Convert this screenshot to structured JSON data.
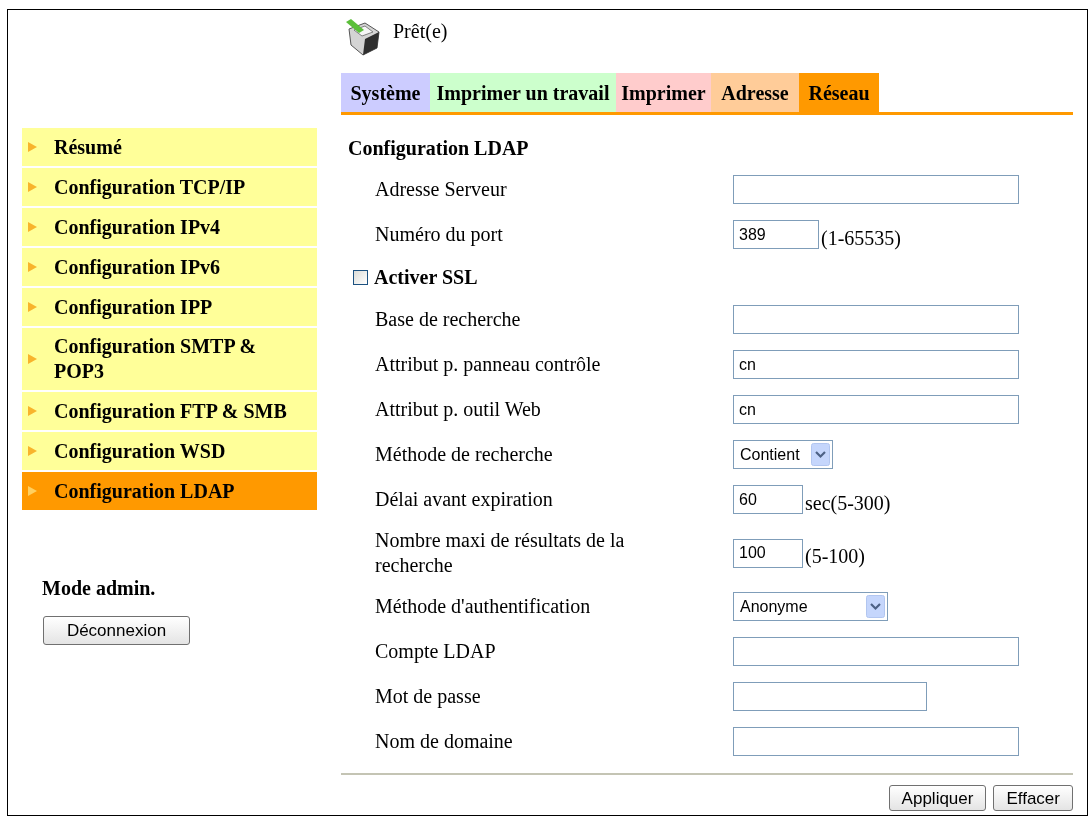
{
  "status": {
    "text": "Prêt(e)"
  },
  "tabs": [
    {
      "label": "Système",
      "color": "#ccccff",
      "selected": false
    },
    {
      "label": "Imprimer un travail",
      "color": "#ccffcc",
      "selected": false
    },
    {
      "label": "Imprimer",
      "color": "#ffcccc",
      "selected": false
    },
    {
      "label": "Adresse",
      "color": "#ffcc99",
      "selected": false
    },
    {
      "label": "Réseau",
      "color": "#ff9900",
      "selected": true
    }
  ],
  "sidebar": {
    "items": [
      {
        "label": "Résumé",
        "selected": false
      },
      {
        "label": "Configuration TCP/IP",
        "selected": false
      },
      {
        "label": "Configuration IPv4",
        "selected": false
      },
      {
        "label": "Configuration IPv6",
        "selected": false
      },
      {
        "label": "Configuration IPP",
        "selected": false
      },
      {
        "label": "Configuration SMTP & POP3",
        "selected": false
      },
      {
        "label": "Configuration FTP & SMB",
        "selected": false
      },
      {
        "label": "Configuration WSD",
        "selected": false
      },
      {
        "label": "Configuration LDAP",
        "selected": true
      }
    ],
    "admin": {
      "title": "Mode admin.",
      "logout_button": "Déconnexion"
    }
  },
  "form": {
    "title": "Configuration LDAP",
    "rows": [
      {
        "kind": "text",
        "label": "Adresse Serveur"
      },
      {
        "kind": "text",
        "label": "Numéro du port",
        "value": "389",
        "unit": "(1-65535)"
      },
      {
        "kind": "checkbox",
        "label": "Activer SSL",
        "checked": false
      },
      {
        "kind": "text",
        "label": "Base de recherche"
      },
      {
        "kind": "text",
        "label": "Attribut p. panneau contrôle",
        "value": "cn"
      },
      {
        "kind": "text",
        "label": "Attribut p. outil Web",
        "value": "cn"
      },
      {
        "kind": "select",
        "label": "Méthode de recherche",
        "value": "Contient"
      },
      {
        "kind": "text",
        "label": "Délai avant expiration",
        "value": "60",
        "unit": "sec(5-300)"
      },
      {
        "kind": "text",
        "label": "Nombre maxi de résultats de la recherche",
        "value": "100",
        "unit": "(5-100)"
      },
      {
        "kind": "select",
        "label": "Méthode d'authentification",
        "value": "Anonyme"
      },
      {
        "kind": "text",
        "label": "Compte LDAP"
      },
      {
        "kind": "password",
        "label": "Mot de passe"
      },
      {
        "kind": "text",
        "label": "Nom de domaine"
      }
    ],
    "buttons": [
      "Appliquer",
      "Effacer"
    ]
  }
}
